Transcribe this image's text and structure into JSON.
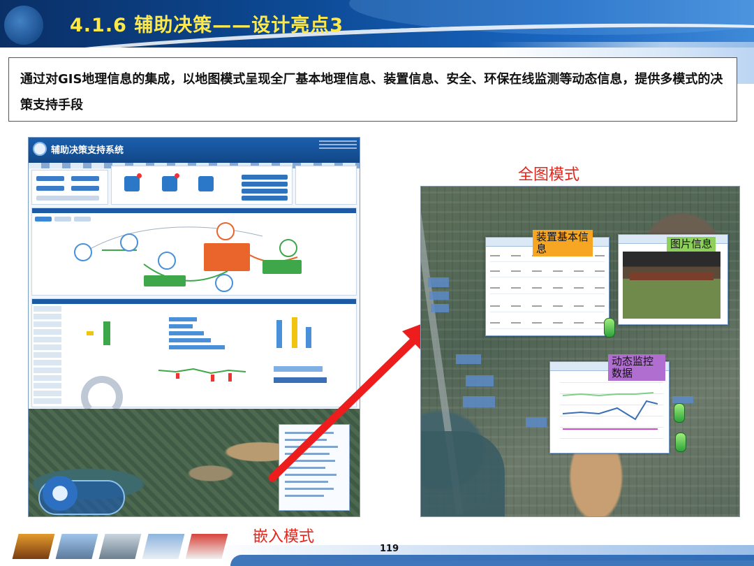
{
  "slide": {
    "title": "4.1.6 辅助决策——设计亮点3",
    "description": "通过对GIS地理信息的集成，以地图模式呈现全厂基本地理信息、装置信息、安全、环保在线监测等动态信息，提供多模式的决策支持手段",
    "page_number": "119"
  },
  "embedded_screenshot": {
    "system_title": "辅助决策支持系统",
    "caption": "嵌入模式"
  },
  "full_map": {
    "caption": "全图模式",
    "labels": {
      "device_info": "装置基本信息",
      "photo_info": "图片信息",
      "monitor_data": "动态监控数据"
    }
  },
  "colors": {
    "title": "#ffe94a",
    "caption": "#e3261c",
    "header_blue": "#0d4a95"
  }
}
